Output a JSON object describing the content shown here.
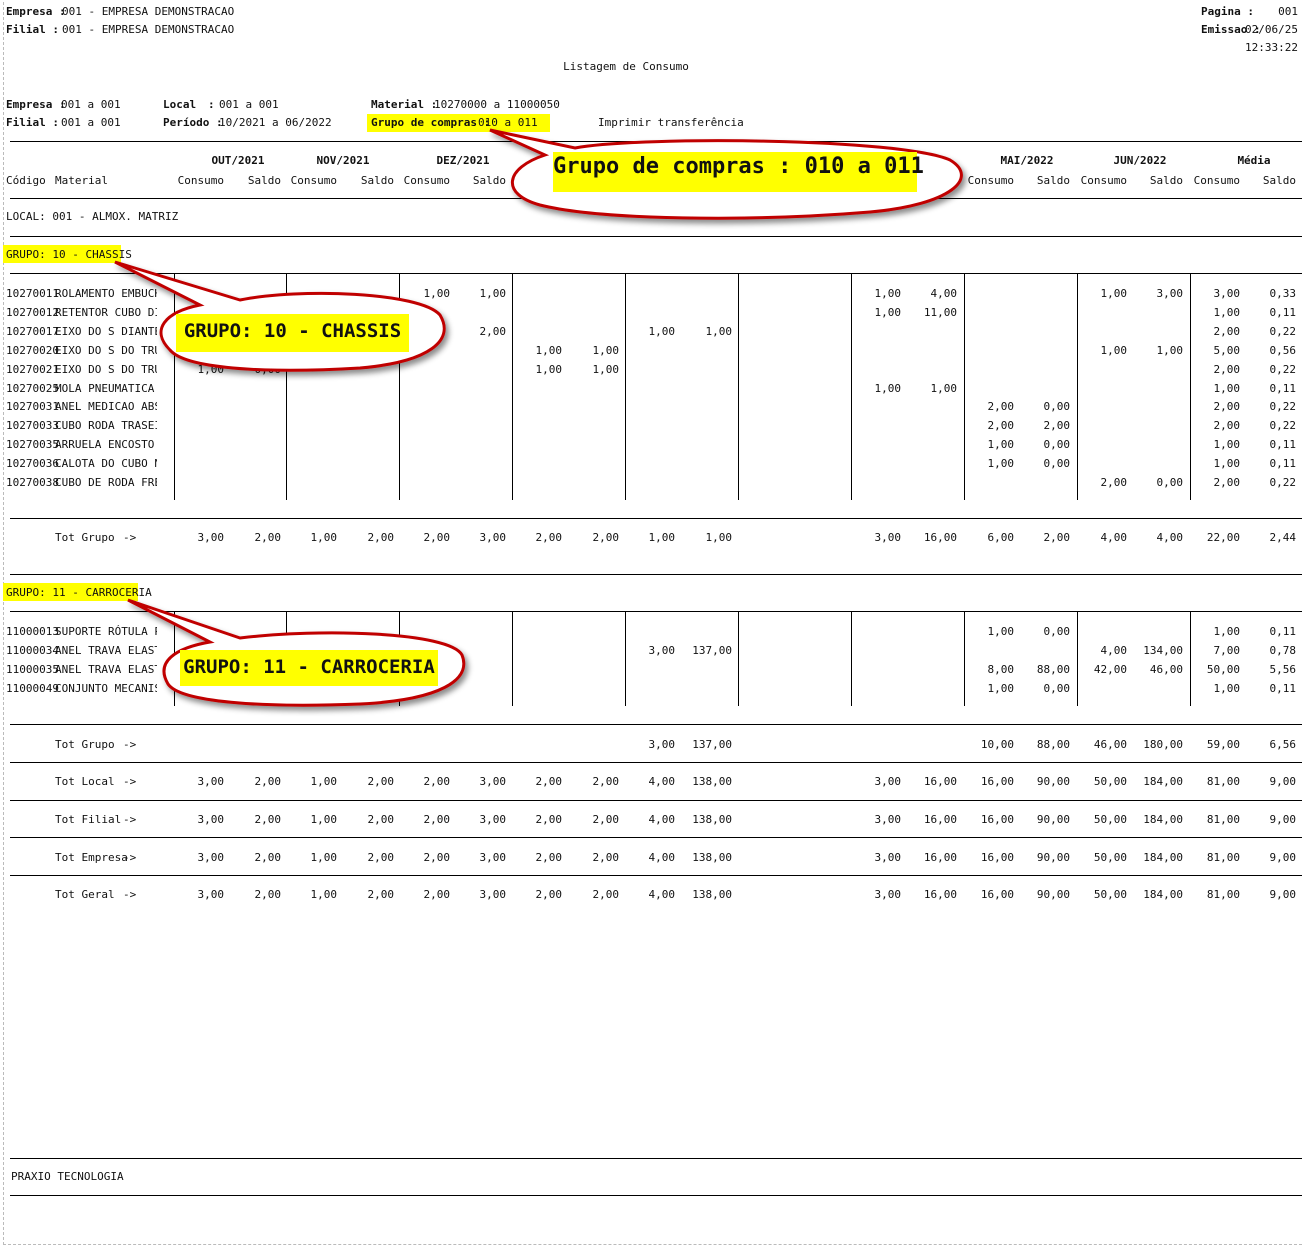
{
  "header": {
    "empresa_label": "Empresa :",
    "empresa_value": "001 - EMPRESA DEMONSTRACAO",
    "filial_label": "Filial  :",
    "filial_value": "001 - EMPRESA DEMONSTRACAO",
    "pagina_label": "Pagina  :",
    "pagina_value": "001",
    "emissao_label": "Emissao :",
    "emissao_value": "02/06/25",
    "hora_value": "12:33:22",
    "report_title": "Listagem de Consumo"
  },
  "filters": {
    "empresa_label": "Empresa :",
    "empresa_value": "001 a 001",
    "filial_label": "Filial  :",
    "filial_value": "001 a 001",
    "local_label": "Local",
    "local_colon": ":",
    "local_value": "001 a 001",
    "periodo_label": "Período :",
    "periodo_value": "10/2021 a 06/2022",
    "material_label": "Material :",
    "material_value": "10270000 a 11000050",
    "grupo_label": "Grupo de compras :",
    "grupo_value": "010 a 011",
    "imprimir": "Imprimir transferência"
  },
  "columns": {
    "codigo": "Código",
    "material": "Material",
    "consumo": "Consumo",
    "saldo": "Saldo",
    "months": [
      "OUT/2021",
      "NOV/2021",
      "DEZ/2021",
      "MAI/2022",
      "JUN/2022",
      "Média"
    ]
  },
  "local": "LOCAL: 001 - ALMOX. MATRIZ",
  "groups": [
    {
      "label": "GRUPO: 10 - CHASSIS",
      "rows": [
        {
          "code": "10270011",
          "name": "ROLAMENTO EMBUCHAM",
          "cells": [
            "",
            "",
            "",
            "",
            "1,00",
            "1,00",
            "",
            "",
            "",
            "",
            "",
            "",
            "1,00",
            "4,00",
            "",
            "",
            "1,00",
            "3,00",
            "3,00",
            "0,33"
          ]
        },
        {
          "code": "10270012",
          "name": "RETENTOR CUBO DIAN",
          "cells": [
            "",
            "",
            "",
            "",
            "",
            "",
            "",
            "",
            "",
            "",
            "",
            "",
            "1,00",
            "11,00",
            "",
            "",
            "",
            "",
            "1,00",
            "0,11"
          ]
        },
        {
          "code": "10270017",
          "name": "EIXO DO S DIANTEIR",
          "cells": [
            "",
            "",
            "",
            "",
            "",
            "2,00",
            "",
            "",
            "1,00",
            "1,00",
            "",
            "",
            "",
            "",
            "",
            "",
            "",
            "",
            "2,00",
            "0,22"
          ]
        },
        {
          "code": "10270020",
          "name": "EIXO DO S DO TRUCK",
          "cells": [
            "",
            "",
            "",
            "",
            "",
            "",
            "1,00",
            "1,00",
            "",
            "",
            "",
            "",
            "",
            "",
            "",
            "",
            "1,00",
            "1,00",
            "5,00",
            "0,56"
          ]
        },
        {
          "code": "10270021",
          "name": "EIXO DO S DO TRUCK",
          "cells": [
            "1,00",
            "0,00",
            "",
            "",
            "",
            "",
            "1,00",
            "1,00",
            "",
            "",
            "",
            "",
            "",
            "",
            "",
            "",
            "",
            "",
            "2,00",
            "0,22"
          ]
        },
        {
          "code": "10270025",
          "name": "MOLA PNEUMATICA SE",
          "cells": [
            "",
            "",
            "",
            "",
            "",
            "",
            "",
            "",
            "",
            "",
            "",
            "",
            "1,00",
            "1,00",
            "",
            "",
            "",
            "",
            "1,00",
            "0,11"
          ]
        },
        {
          "code": "10270031",
          "name": "ANEL MEDICAO ABS C",
          "cells": [
            "",
            "",
            "",
            "",
            "",
            "",
            "",
            "",
            "",
            "",
            "",
            "",
            "",
            "",
            "2,00",
            "0,00",
            "",
            "",
            "2,00",
            "0,22"
          ]
        },
        {
          "code": "10270033",
          "name": "CUBO RODA TRASEIRO",
          "cells": [
            "",
            "",
            "",
            "",
            "",
            "",
            "",
            "",
            "",
            "",
            "",
            "",
            "",
            "",
            "2,00",
            "2,00",
            "",
            "",
            "2,00",
            "0,22"
          ]
        },
        {
          "code": "10270035",
          "name": "ARRUELA ENCOSTO TA",
          "cells": [
            "",
            "",
            "",
            "",
            "",
            "",
            "",
            "",
            "",
            "",
            "",
            "",
            "",
            "",
            "1,00",
            "0,00",
            "",
            "",
            "1,00",
            "0,11"
          ]
        },
        {
          "code": "10270036",
          "name": "CALOTA DO CUBO NA",
          "cells": [
            "",
            "",
            "",
            "",
            "",
            "",
            "",
            "",
            "",
            "",
            "",
            "",
            "",
            "",
            "1,00",
            "0,00",
            "",
            "",
            "1,00",
            "0,11"
          ]
        },
        {
          "code": "10270038",
          "name": "CUBO DE RODA FREIO",
          "cells": [
            "",
            "",
            "",
            "",
            "",
            "",
            "",
            "",
            "",
            "",
            "",
            "",
            "",
            "",
            "",
            "",
            "2,00",
            "0,00",
            "2,00",
            "0,22"
          ]
        }
      ],
      "total": {
        "label": "Tot Grupo",
        "arrow": "->",
        "cells": [
          "3,00",
          "2,00",
          "1,00",
          "2,00",
          "2,00",
          "3,00",
          "2,00",
          "2,00",
          "1,00",
          "1,00",
          "",
          "",
          "3,00",
          "16,00",
          "6,00",
          "2,00",
          "4,00",
          "4,00",
          "22,00",
          "2,44"
        ]
      }
    },
    {
      "label": "GRUPO: 11 - CARROCERIA",
      "rows": [
        {
          "code": "11000013",
          "name": "SUPORTE RÓTULA POR",
          "cells": [
            "",
            "",
            "",
            "",
            "",
            "",
            "",
            "",
            "",
            "",
            "",
            "",
            "",
            "",
            "1,00",
            "0,00",
            "",
            "",
            "1,00",
            "0,11"
          ]
        },
        {
          "code": "11000034",
          "name": "ANEL TRAVA ELASTIC",
          "cells": [
            "",
            "",
            "",
            "",
            "",
            "",
            "",
            "",
            "3,00",
            "137,00",
            "",
            "",
            "",
            "",
            "",
            "",
            "4,00",
            "134,00",
            "7,00",
            "0,78"
          ]
        },
        {
          "code": "11000035",
          "name": "ANEL TRAVA ELASTIC",
          "cells": [
            "",
            "",
            "",
            "",
            "",
            "",
            "",
            "",
            "",
            "",
            "",
            "",
            "",
            "",
            "8,00",
            "88,00",
            "42,00",
            "46,00",
            "50,00",
            "5,56"
          ]
        },
        {
          "code": "11000049",
          "name": "CONJUNTO MECANISMO",
          "cells": [
            "",
            "",
            "",
            "",
            "",
            "",
            "",
            "",
            "",
            "",
            "",
            "",
            "",
            "",
            "1,00",
            "0,00",
            "",
            "",
            "1,00",
            "0,11"
          ]
        }
      ],
      "total": {
        "label": "Tot Grupo",
        "arrow": "->",
        "cells": [
          "",
          "",
          "",
          "",
          "",
          "",
          "",
          "",
          "3,00",
          "137,00",
          "",
          "",
          "",
          "",
          "10,00",
          "88,00",
          "46,00",
          "180,00",
          "59,00",
          "6,56"
        ]
      }
    }
  ],
  "totals": [
    {
      "label": "Tot Local",
      "arrow": "->",
      "cells": [
        "3,00",
        "2,00",
        "1,00",
        "2,00",
        "2,00",
        "3,00",
        "2,00",
        "2,00",
        "4,00",
        "138,00",
        "",
        "",
        "3,00",
        "16,00",
        "16,00",
        "90,00",
        "50,00",
        "184,00",
        "81,00",
        "9,00"
      ]
    },
    {
      "label": "Tot Filial",
      "arrow": "->",
      "cells": [
        "3,00",
        "2,00",
        "1,00",
        "2,00",
        "2,00",
        "3,00",
        "2,00",
        "2,00",
        "4,00",
        "138,00",
        "",
        "",
        "3,00",
        "16,00",
        "16,00",
        "90,00",
        "50,00",
        "184,00",
        "81,00",
        "9,00"
      ]
    },
    {
      "label": "Tot Empresa",
      "arrow": "->",
      "cells": [
        "3,00",
        "2,00",
        "1,00",
        "2,00",
        "2,00",
        "3,00",
        "2,00",
        "2,00",
        "4,00",
        "138,00",
        "",
        "",
        "3,00",
        "16,00",
        "16,00",
        "90,00",
        "50,00",
        "184,00",
        "81,00",
        "9,00"
      ]
    },
    {
      "label": "Tot Geral",
      "arrow": "->",
      "cells": [
        "3,00",
        "2,00",
        "1,00",
        "2,00",
        "2,00",
        "3,00",
        "2,00",
        "2,00",
        "4,00",
        "138,00",
        "",
        "",
        "3,00",
        "16,00",
        "16,00",
        "90,00",
        "50,00",
        "184,00",
        "81,00",
        "9,00"
      ]
    }
  ],
  "footer": "PRAXIO TECNOLOGIA",
  "callouts": {
    "grupo_compras": "Grupo de compras : 010 a 011",
    "grupo_10": "GRUPO: 10 - CHASSIS",
    "grupo_11": "GRUPO: 11 - CARROCERIA"
  }
}
